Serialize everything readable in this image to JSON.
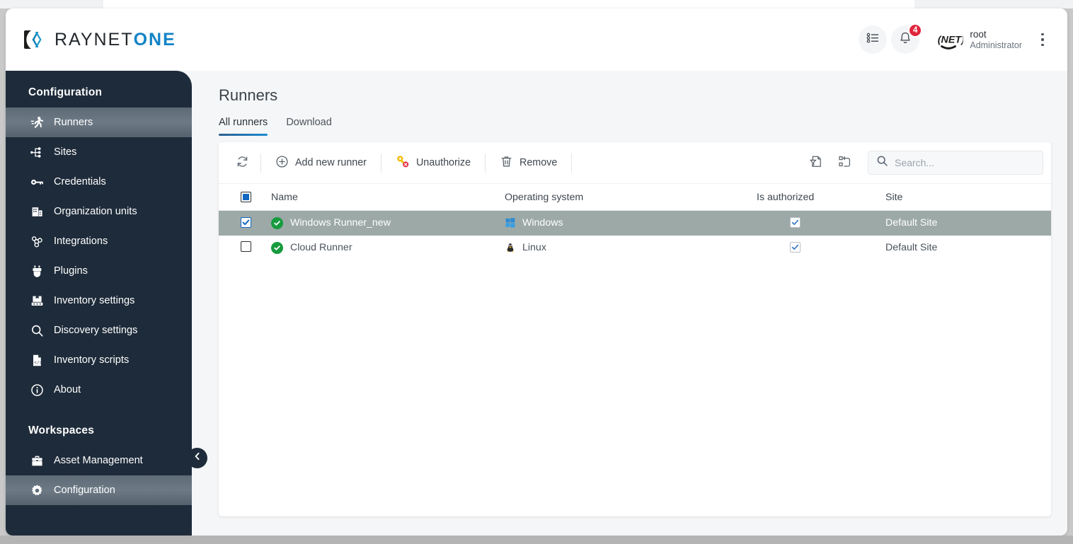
{
  "brand": {
    "name_dark": "RAYNET",
    "name_accent": "ONE",
    "accent_color": "#1383c6"
  },
  "header": {
    "list_icon": "list-icon",
    "bell_icon": "bell-icon",
    "notification_count": "4",
    "user_name": "root",
    "user_role": "Administrator",
    "avatar_text": "NET",
    "kebab_icon": "more-vertical-icon"
  },
  "sidebar": {
    "section_configuration": "Configuration",
    "section_workspaces": "Workspaces",
    "items": [
      {
        "label": "Runners",
        "icon": "runner-icon",
        "active": true
      },
      {
        "label": "Sites",
        "icon": "sitemap-icon",
        "active": false
      },
      {
        "label": "Credentials",
        "icon": "key-icon",
        "active": false
      },
      {
        "label": "Organization units",
        "icon": "building-icon",
        "active": false
      },
      {
        "label": "Integrations",
        "icon": "integrations-icon",
        "active": false
      },
      {
        "label": "Plugins",
        "icon": "plugin-icon",
        "active": false
      },
      {
        "label": "Inventory settings",
        "icon": "inventory-icon",
        "active": false
      },
      {
        "label": "Discovery settings",
        "icon": "search-icon",
        "active": false
      },
      {
        "label": "Inventory scripts",
        "icon": "script-file-icon",
        "active": false
      },
      {
        "label": "About",
        "icon": "info-icon",
        "active": false
      }
    ],
    "workspace_items": [
      {
        "label": "Asset Management",
        "icon": "briefcase-icon",
        "active": false
      },
      {
        "label": "Configuration",
        "icon": "gear-icon",
        "active": true
      }
    ],
    "collapse_icon": "chevron-left-icon"
  },
  "main": {
    "page_title": "Runners",
    "tabs": [
      {
        "label": "All runners",
        "active": true
      },
      {
        "label": "Download",
        "active": false
      }
    ],
    "toolbar": {
      "refresh_label": "",
      "refresh_icon": "refresh-icon",
      "add_label": "Add new runner",
      "add_icon": "plus-circle-icon",
      "unauthorize_label": "Unauthorize",
      "unauthorize_icon": "key-revoke-icon",
      "remove_label": "Remove",
      "remove_icon": "trash-icon",
      "filter_icon": "filter-document-icon",
      "columns_icon": "columns-layout-icon"
    },
    "search": {
      "value": "",
      "placeholder": "Search...",
      "icon": "search-icon"
    },
    "table": {
      "select_all_state": "indeterminate",
      "columns": [
        "Name",
        "Operating system",
        "Is authorized",
        "Site"
      ],
      "rows": [
        {
          "selected": true,
          "checked": true,
          "status": "ok",
          "name": "Windows Runner_new",
          "os": "Windows",
          "os_icon": "windows-icon",
          "is_authorized": true,
          "site": "Default Site"
        },
        {
          "selected": false,
          "checked": false,
          "status": "ok",
          "name": "Cloud Runner",
          "os": "Linux",
          "os_icon": "linux-icon",
          "is_authorized": true,
          "site": "Default Site"
        }
      ]
    }
  }
}
